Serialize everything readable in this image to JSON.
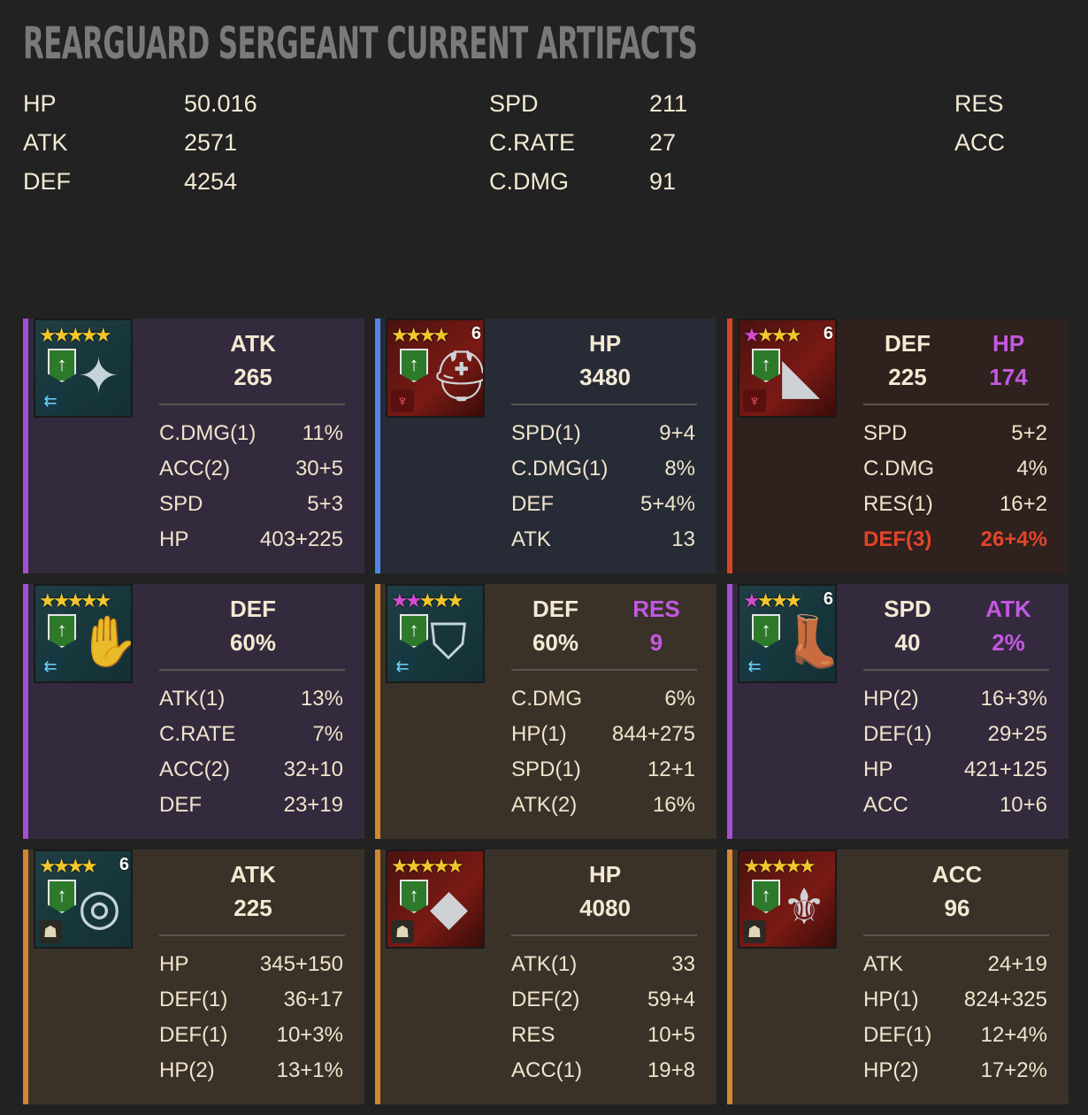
{
  "title": "REARGUARD SERGEANT CURRENT ARTIFACTS",
  "stats": {
    "col1": [
      {
        "label": "HP",
        "value": "50.016"
      },
      {
        "label": "ATK",
        "value": "2571"
      },
      {
        "label": "DEF",
        "value": "4254"
      }
    ],
    "col2": [
      {
        "label": "SPD",
        "value": "211"
      },
      {
        "label": "C.RATE",
        "value": "27"
      },
      {
        "label": "C.DMG",
        "value": "91"
      }
    ],
    "col3": [
      {
        "label": "RES",
        "value": ""
      },
      {
        "label": "ACC",
        "value": ""
      }
    ]
  },
  "colors": {
    "purple": "#a44fd6",
    "blue": "#4f86ea",
    "red": "#d8442b",
    "orange": "#d6862e",
    "secondary_stat": "#c458e2",
    "highlight_sub": "#e2452c"
  },
  "cards": [
    {
      "rarity": "purple",
      "stars": "★★★★★",
      "pink_stars": 0,
      "rank6": "",
      "set_icon": "speed-set-icon",
      "glyph": "✦",
      "bg": "teal",
      "main": [
        {
          "label": "ATK",
          "value": "265"
        }
      ],
      "subs": [
        {
          "label": "C.DMG(1)",
          "value": "11%"
        },
        {
          "label": "ACC(2)",
          "value": "30+5"
        },
        {
          "label": "SPD",
          "value": "5+3"
        },
        {
          "label": "HP",
          "value": "403+225"
        }
      ]
    },
    {
      "rarity": "blue",
      "stars": "★★★★",
      "pink_stars": 0,
      "rank6": "6",
      "set_icon": "lifesteal-set-icon",
      "glyph": "⛑",
      "bg": "redbg",
      "main": [
        {
          "label": "HP",
          "value": "3480"
        }
      ],
      "subs": [
        {
          "label": "SPD(1)",
          "value": "9+4"
        },
        {
          "label": "C.DMG(1)",
          "value": "8%"
        },
        {
          "label": "DEF",
          "value": "5+4%"
        },
        {
          "label": "ATK",
          "value": "13"
        }
      ]
    },
    {
      "rarity": "red",
      "stars": "★★★",
      "pink_stars": 1,
      "rank6": "6",
      "set_icon": "lifesteal-set-icon",
      "glyph": "◣",
      "bg": "redbg",
      "main": [
        {
          "label": "DEF",
          "value": "225"
        },
        {
          "label": "HP",
          "value": "174"
        }
      ],
      "subs": [
        {
          "label": "SPD",
          "value": "5+2"
        },
        {
          "label": "C.DMG",
          "value": "4%"
        },
        {
          "label": "RES(1)",
          "value": "16+2"
        },
        {
          "label": "DEF(3)",
          "value": "26+4%",
          "hl": true
        }
      ]
    },
    {
      "rarity": "purple",
      "stars": "★★★★★",
      "pink_stars": 0,
      "rank6": "",
      "set_icon": "speed-set-icon",
      "glyph": "✋",
      "bg": "teal",
      "main": [
        {
          "label": "DEF",
          "value": "60%"
        }
      ],
      "subs": [
        {
          "label": "ATK(1)",
          "value": "13%"
        },
        {
          "label": "C.RATE",
          "value": "7%"
        },
        {
          "label": "ACC(2)",
          "value": "32+10"
        },
        {
          "label": "DEF",
          "value": "23+19"
        }
      ]
    },
    {
      "rarity": "orange",
      "stars": "★★★",
      "pink_stars": 2,
      "rank6": "",
      "set_icon": "speed-set-icon",
      "glyph": "⛉",
      "bg": "teal",
      "main": [
        {
          "label": "DEF",
          "value": "60%"
        },
        {
          "label": "RES",
          "value": "9"
        }
      ],
      "subs": [
        {
          "label": "C.DMG",
          "value": "6%"
        },
        {
          "label": "HP(1)",
          "value": "844+275"
        },
        {
          "label": "SPD(1)",
          "value": "12+1"
        },
        {
          "label": "ATK(2)",
          "value": "16%"
        }
      ]
    },
    {
      "rarity": "purple",
      "stars": "★★★",
      "pink_stars": 1,
      "rank6": "6",
      "set_icon": "speed-set-icon",
      "glyph": "👢",
      "bg": "teal",
      "main": [
        {
          "label": "SPD",
          "value": "40"
        },
        {
          "label": "ATK",
          "value": "2%"
        }
      ],
      "subs": [
        {
          "label": "HP(2)",
          "value": "16+3%"
        },
        {
          "label": "DEF(1)",
          "value": "29+25"
        },
        {
          "label": "HP",
          "value": "421+125"
        },
        {
          "label": "ACC",
          "value": "10+6"
        }
      ]
    },
    {
      "rarity": "orange",
      "stars": "★★★★",
      "pink_stars": 0,
      "rank6": "6",
      "set_icon": "helm-set-icon",
      "glyph": "◎",
      "bg": "teal",
      "main": [
        {
          "label": "ATK",
          "value": "225"
        }
      ],
      "subs": [
        {
          "label": "HP",
          "value": "345+150"
        },
        {
          "label": "DEF(1)",
          "value": "36+17"
        },
        {
          "label": "DEF(1)",
          "value": "10+3%"
        },
        {
          "label": "HP(2)",
          "value": "13+1%"
        }
      ]
    },
    {
      "rarity": "orange",
      "stars": "★★★★★",
      "pink_stars": 0,
      "rank6": "",
      "set_icon": "helm-set-icon",
      "glyph": "◆",
      "bg": "redbg",
      "main": [
        {
          "label": "HP",
          "value": "4080"
        }
      ],
      "subs": [
        {
          "label": "ATK(1)",
          "value": "33"
        },
        {
          "label": "DEF(2)",
          "value": "59+4"
        },
        {
          "label": "RES",
          "value": "10+5"
        },
        {
          "label": "ACC(1)",
          "value": "19+8"
        }
      ]
    },
    {
      "rarity": "orange",
      "stars": "★★★★★",
      "pink_stars": 0,
      "rank6": "",
      "set_icon": "helm-set-icon",
      "glyph": "⚜",
      "bg": "redbg",
      "main": [
        {
          "label": "ACC",
          "value": "96"
        }
      ],
      "subs": [
        {
          "label": "ATK",
          "value": "24+19"
        },
        {
          "label": "HP(1)",
          "value": "824+325"
        },
        {
          "label": "DEF(1)",
          "value": "12+4%"
        },
        {
          "label": "HP(2)",
          "value": "17+2%"
        }
      ]
    }
  ]
}
